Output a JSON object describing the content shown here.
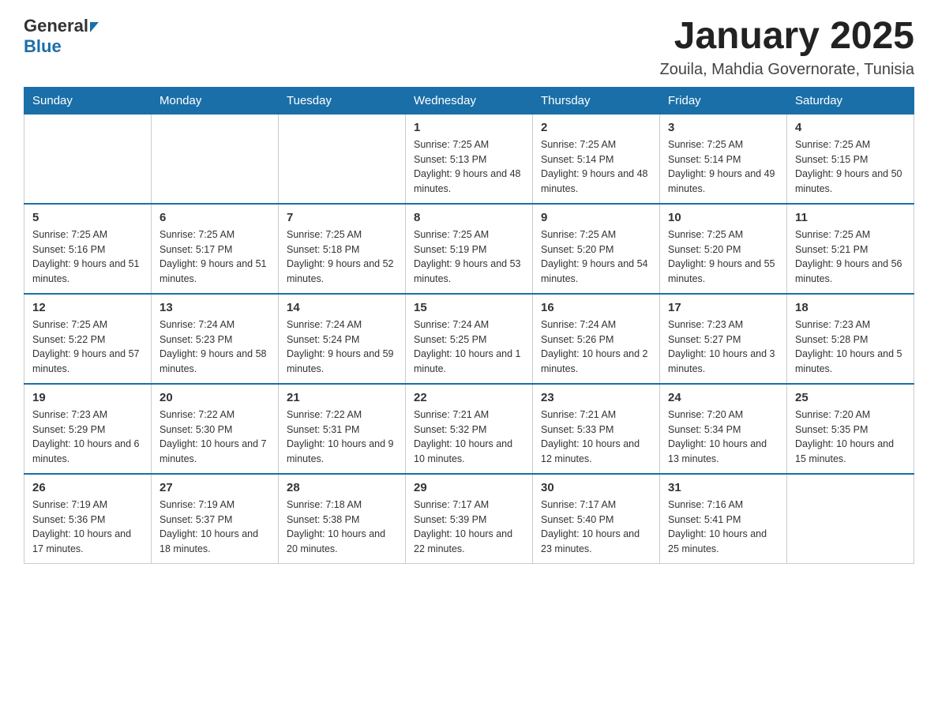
{
  "header": {
    "logo_general": "General",
    "logo_blue": "Blue",
    "month_title": "January 2025",
    "location": "Zouila, Mahdia Governorate, Tunisia"
  },
  "days_of_week": [
    "Sunday",
    "Monday",
    "Tuesday",
    "Wednesday",
    "Thursday",
    "Friday",
    "Saturday"
  ],
  "weeks": [
    [
      {
        "day": "",
        "info": ""
      },
      {
        "day": "",
        "info": ""
      },
      {
        "day": "",
        "info": ""
      },
      {
        "day": "1",
        "info": "Sunrise: 7:25 AM\nSunset: 5:13 PM\nDaylight: 9 hours and 48 minutes."
      },
      {
        "day": "2",
        "info": "Sunrise: 7:25 AM\nSunset: 5:14 PM\nDaylight: 9 hours and 48 minutes."
      },
      {
        "day": "3",
        "info": "Sunrise: 7:25 AM\nSunset: 5:14 PM\nDaylight: 9 hours and 49 minutes."
      },
      {
        "day": "4",
        "info": "Sunrise: 7:25 AM\nSunset: 5:15 PM\nDaylight: 9 hours and 50 minutes."
      }
    ],
    [
      {
        "day": "5",
        "info": "Sunrise: 7:25 AM\nSunset: 5:16 PM\nDaylight: 9 hours and 51 minutes."
      },
      {
        "day": "6",
        "info": "Sunrise: 7:25 AM\nSunset: 5:17 PM\nDaylight: 9 hours and 51 minutes."
      },
      {
        "day": "7",
        "info": "Sunrise: 7:25 AM\nSunset: 5:18 PM\nDaylight: 9 hours and 52 minutes."
      },
      {
        "day": "8",
        "info": "Sunrise: 7:25 AM\nSunset: 5:19 PM\nDaylight: 9 hours and 53 minutes."
      },
      {
        "day": "9",
        "info": "Sunrise: 7:25 AM\nSunset: 5:20 PM\nDaylight: 9 hours and 54 minutes."
      },
      {
        "day": "10",
        "info": "Sunrise: 7:25 AM\nSunset: 5:20 PM\nDaylight: 9 hours and 55 minutes."
      },
      {
        "day": "11",
        "info": "Sunrise: 7:25 AM\nSunset: 5:21 PM\nDaylight: 9 hours and 56 minutes."
      }
    ],
    [
      {
        "day": "12",
        "info": "Sunrise: 7:25 AM\nSunset: 5:22 PM\nDaylight: 9 hours and 57 minutes."
      },
      {
        "day": "13",
        "info": "Sunrise: 7:24 AM\nSunset: 5:23 PM\nDaylight: 9 hours and 58 minutes."
      },
      {
        "day": "14",
        "info": "Sunrise: 7:24 AM\nSunset: 5:24 PM\nDaylight: 9 hours and 59 minutes."
      },
      {
        "day": "15",
        "info": "Sunrise: 7:24 AM\nSunset: 5:25 PM\nDaylight: 10 hours and 1 minute."
      },
      {
        "day": "16",
        "info": "Sunrise: 7:24 AM\nSunset: 5:26 PM\nDaylight: 10 hours and 2 minutes."
      },
      {
        "day": "17",
        "info": "Sunrise: 7:23 AM\nSunset: 5:27 PM\nDaylight: 10 hours and 3 minutes."
      },
      {
        "day": "18",
        "info": "Sunrise: 7:23 AM\nSunset: 5:28 PM\nDaylight: 10 hours and 5 minutes."
      }
    ],
    [
      {
        "day": "19",
        "info": "Sunrise: 7:23 AM\nSunset: 5:29 PM\nDaylight: 10 hours and 6 minutes."
      },
      {
        "day": "20",
        "info": "Sunrise: 7:22 AM\nSunset: 5:30 PM\nDaylight: 10 hours and 7 minutes."
      },
      {
        "day": "21",
        "info": "Sunrise: 7:22 AM\nSunset: 5:31 PM\nDaylight: 10 hours and 9 minutes."
      },
      {
        "day": "22",
        "info": "Sunrise: 7:21 AM\nSunset: 5:32 PM\nDaylight: 10 hours and 10 minutes."
      },
      {
        "day": "23",
        "info": "Sunrise: 7:21 AM\nSunset: 5:33 PM\nDaylight: 10 hours and 12 minutes."
      },
      {
        "day": "24",
        "info": "Sunrise: 7:20 AM\nSunset: 5:34 PM\nDaylight: 10 hours and 13 minutes."
      },
      {
        "day": "25",
        "info": "Sunrise: 7:20 AM\nSunset: 5:35 PM\nDaylight: 10 hours and 15 minutes."
      }
    ],
    [
      {
        "day": "26",
        "info": "Sunrise: 7:19 AM\nSunset: 5:36 PM\nDaylight: 10 hours and 17 minutes."
      },
      {
        "day": "27",
        "info": "Sunrise: 7:19 AM\nSunset: 5:37 PM\nDaylight: 10 hours and 18 minutes."
      },
      {
        "day": "28",
        "info": "Sunrise: 7:18 AM\nSunset: 5:38 PM\nDaylight: 10 hours and 20 minutes."
      },
      {
        "day": "29",
        "info": "Sunrise: 7:17 AM\nSunset: 5:39 PM\nDaylight: 10 hours and 22 minutes."
      },
      {
        "day": "30",
        "info": "Sunrise: 7:17 AM\nSunset: 5:40 PM\nDaylight: 10 hours and 23 minutes."
      },
      {
        "day": "31",
        "info": "Sunrise: 7:16 AM\nSunset: 5:41 PM\nDaylight: 10 hours and 25 minutes."
      },
      {
        "day": "",
        "info": ""
      }
    ]
  ]
}
